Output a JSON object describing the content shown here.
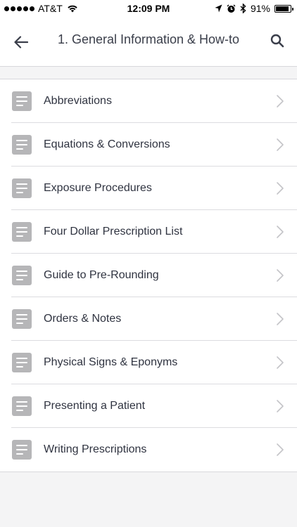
{
  "status": {
    "carrier": "AT&T",
    "time": "12:09 PM",
    "battery": "91%",
    "battery_level": 0.91
  },
  "nav": {
    "title": "1. General Information & How-to"
  },
  "items": [
    {
      "label": "Abbreviations"
    },
    {
      "label": "Equations & Conversions"
    },
    {
      "label": "Exposure Procedures"
    },
    {
      "label": "Four Dollar Prescription List"
    },
    {
      "label": "Guide to Pre-Rounding"
    },
    {
      "label": "Orders & Notes"
    },
    {
      "label": "Physical Signs & Eponyms"
    },
    {
      "label": "Presenting a Patient"
    },
    {
      "label": "Writing Prescriptions"
    }
  ]
}
